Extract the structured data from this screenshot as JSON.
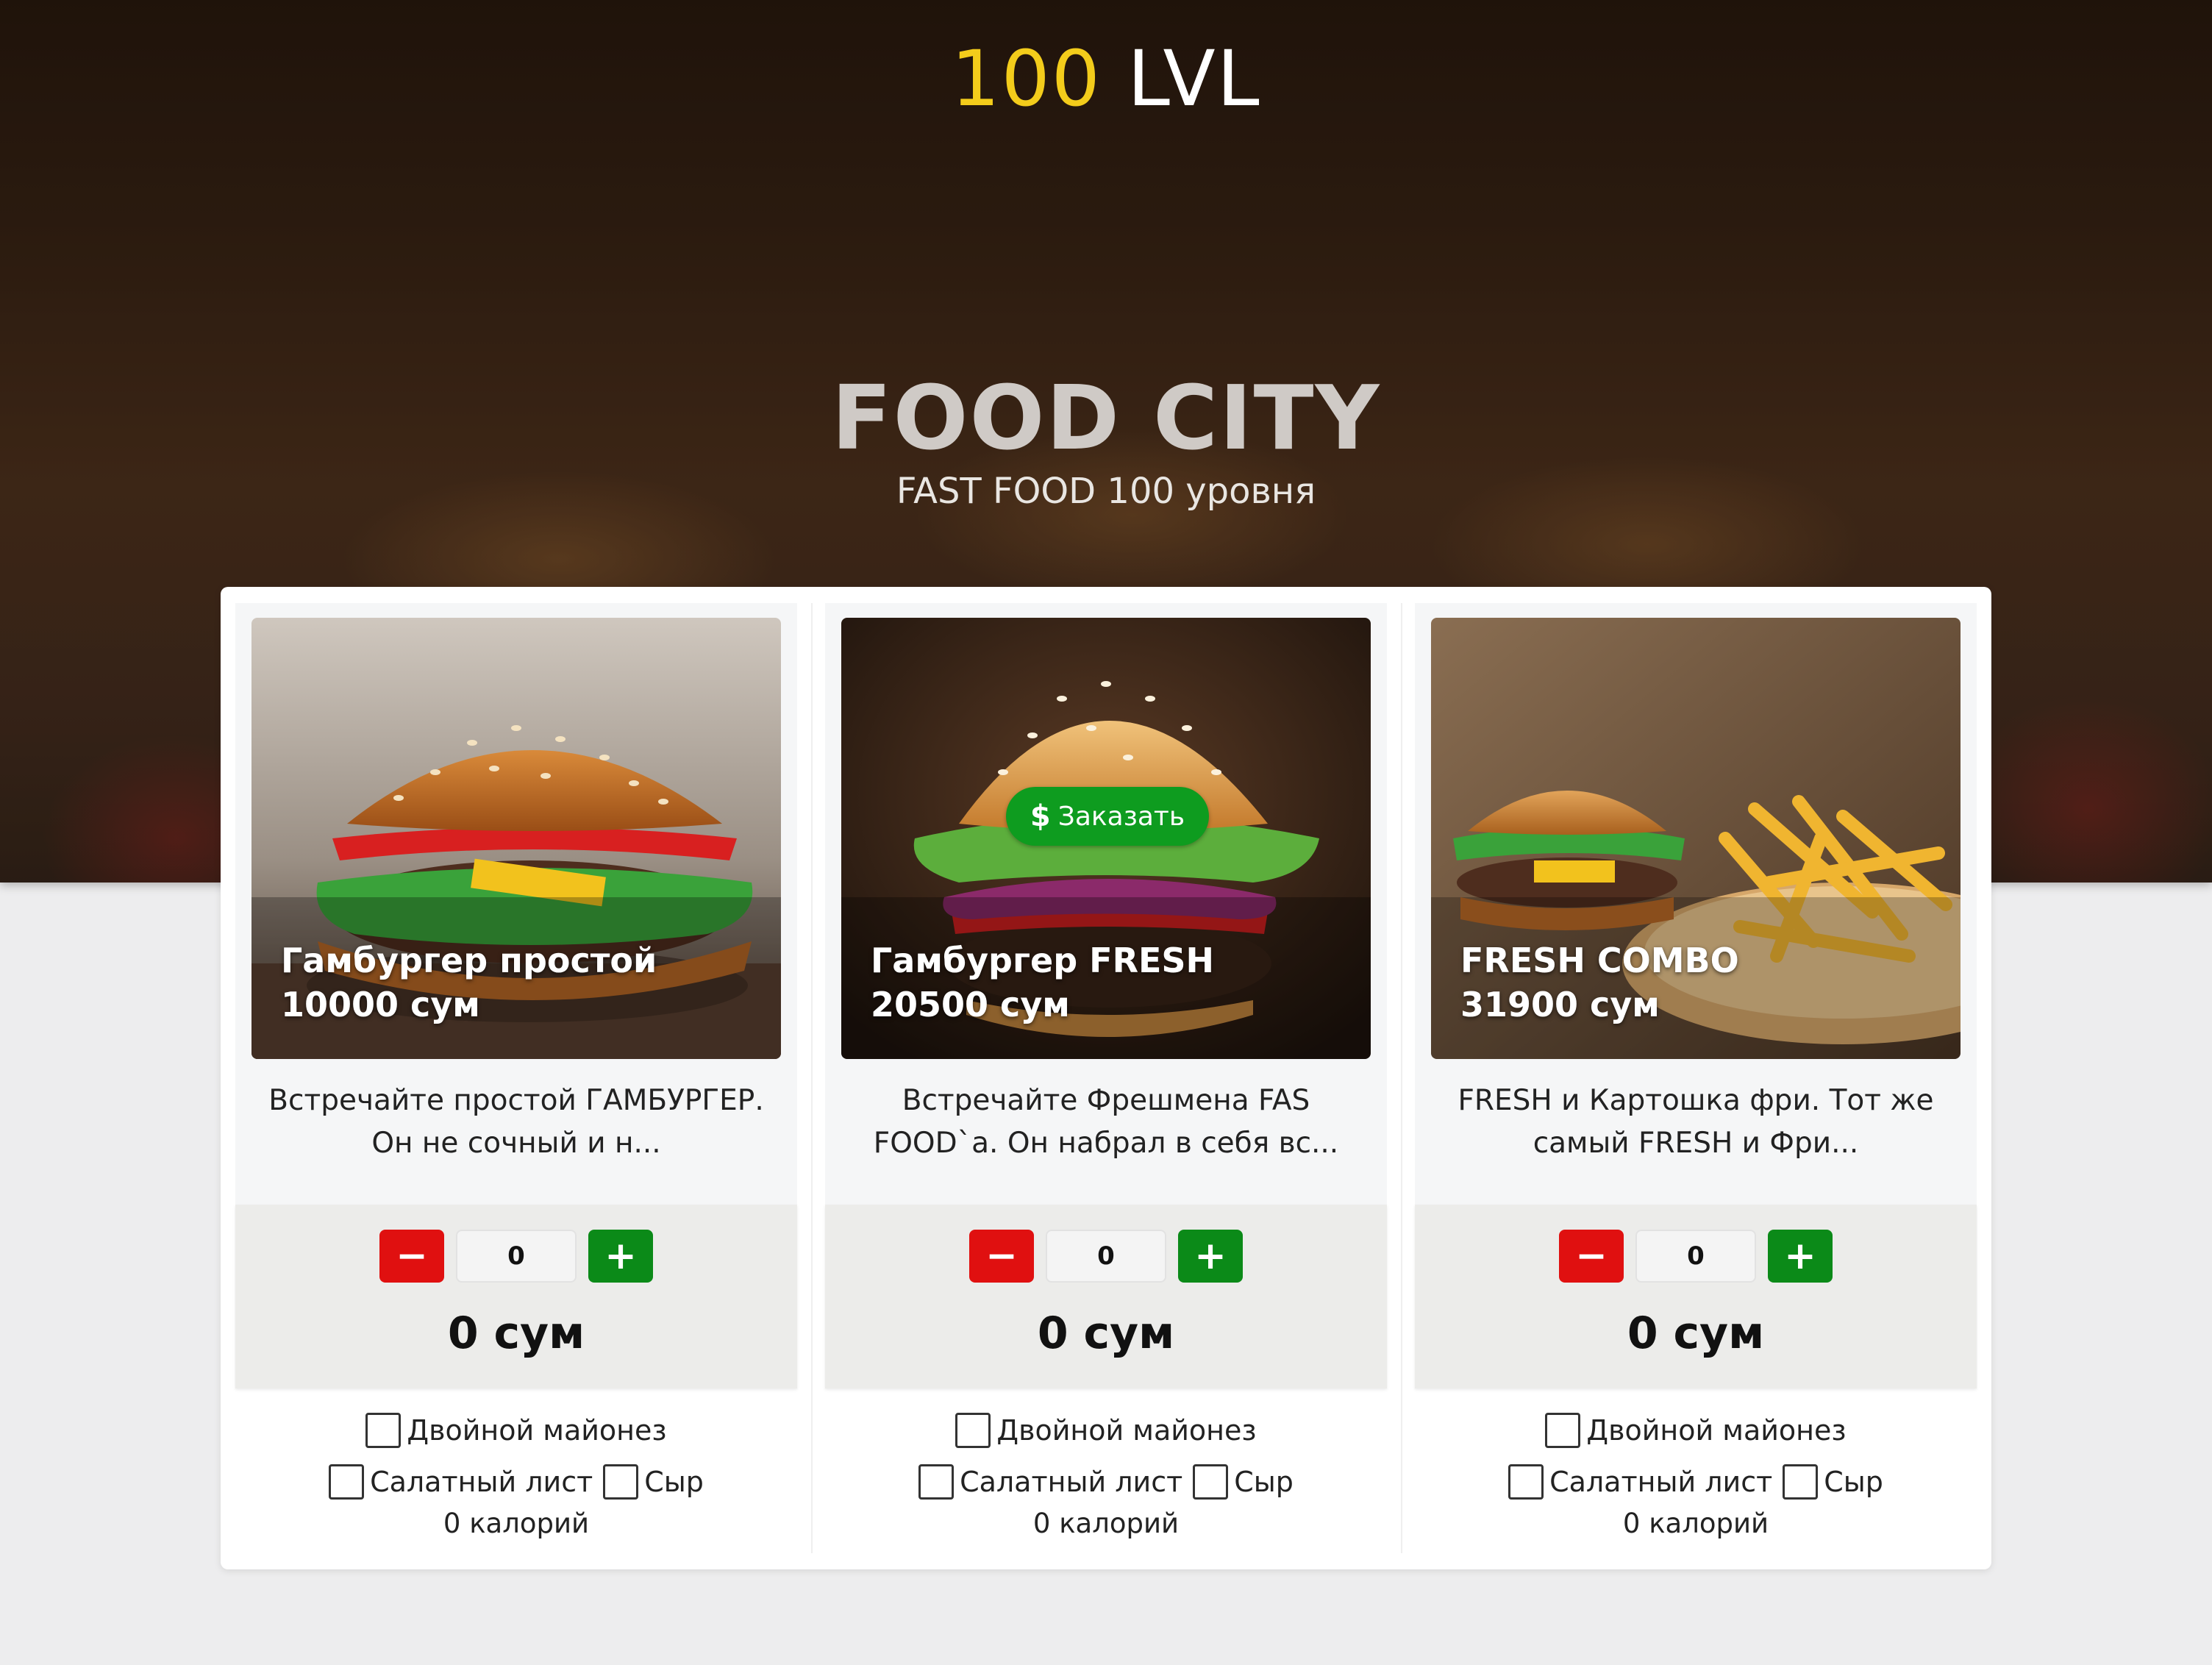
{
  "header": {
    "logo_number": "100",
    "logo_text": "LVL",
    "title": "FOOD CITY",
    "subtitle": "FAST FOOD 100 уровня"
  },
  "colors": {
    "logo_accent": "#f3cc1b",
    "minus_button": "#e01010",
    "plus_button": "#0b8a18",
    "order_button": "#0e9c1f"
  },
  "products": [
    {
      "name": "Гамбургер простой",
      "price": "10000 сум",
      "description": "Встречайте простой ГАМБУРГЕР. Он не сочный и н...",
      "quantity": "0",
      "total": "0 сум",
      "option_mayo": "Двойной майонез",
      "option_lettuce": "Салатный лист",
      "option_cheese": "Сыр",
      "calories": "0 калорий"
    },
    {
      "name": "Гамбургер FRESH",
      "price": "20500 сум",
      "description": "Встречайте Фрешмена FAS FOOD`a. Он набрал в себя вс...",
      "order_label": "Заказать",
      "order_icon": "dollar-icon",
      "quantity": "0",
      "total": "0 сум",
      "option_mayo": "Двойной майонез",
      "option_lettuce": "Салатный лист",
      "option_cheese": "Сыр",
      "calories": "0 калорий"
    },
    {
      "name": "FRESH COMBO",
      "price": "31900 сум",
      "description": "FRESH и Картошка фри. Тот же самый FRESH и Фри...",
      "quantity": "0",
      "total": "0 сум",
      "option_mayo": "Двойной майонез",
      "option_lettuce": "Салатный лист",
      "option_cheese": "Сыр",
      "calories": "0 калорий"
    }
  ],
  "controls": {
    "minus_icon": "minus-icon",
    "plus_icon": "plus-icon"
  }
}
